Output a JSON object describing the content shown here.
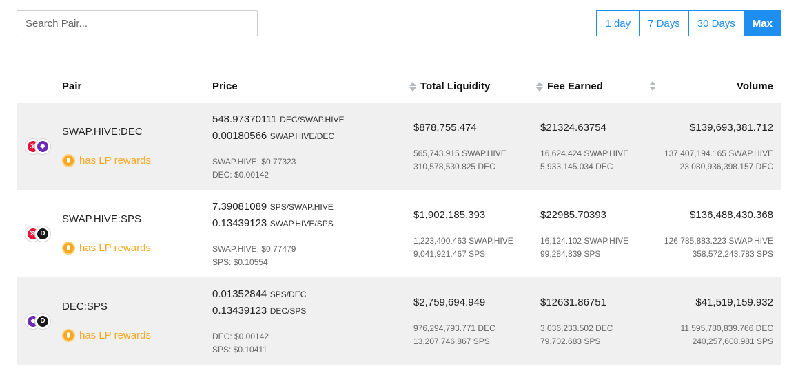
{
  "search": {
    "placeholder": "Search Pair..."
  },
  "periods": [
    {
      "label": "1 day",
      "active": false
    },
    {
      "label": "7 Days",
      "active": false
    },
    {
      "label": "30 Days",
      "active": false
    },
    {
      "label": "Max",
      "active": true
    }
  ],
  "colors": {
    "accent": "#1f8ef1",
    "lp": "#f6a823",
    "row_shade": "#f0f0f0",
    "hive": "#e31337",
    "dec": "#6b2bb5",
    "sps": "#1a1a1a"
  },
  "header": {
    "pair": "Pair",
    "price": "Price",
    "liquidity": "Total Liquidity",
    "fee": "Fee Earned",
    "volume": "Volume"
  },
  "lp_label": "has LP rewards",
  "rows": [
    {
      "pair": "SWAP.HIVE:DEC",
      "icons": [
        "hive-icon",
        "dec-icon"
      ],
      "price1": "548.97370111",
      "unit1": "DEC/SWAP.HIVE",
      "price2": "0.00180566",
      "unit2": "SWAP.HIVE/DEC",
      "usd1": "SWAP.HIVE: $0.77323",
      "usd2": "DEC: $0.00142",
      "liquidity": "$878,755.474",
      "liq1": "565,743.915 SWAP.HIVE",
      "liq2": "310,578,530.825 DEC",
      "fee": "$21324.63754",
      "fee1": "16,624.424 SWAP.HIVE",
      "fee2": "5,933,145.034 DEC",
      "volume": "$139,693,381.712",
      "vol1": "137,407,194.165 SWAP.HIVE",
      "vol2": "23,080,936,398.157 DEC"
    },
    {
      "pair": "SWAP.HIVE:SPS",
      "icons": [
        "hive-icon",
        "sps-icon"
      ],
      "price1": "7.39081089",
      "unit1": "SPS/SWAP.HIVE",
      "price2": "0.13439123",
      "unit2": "SWAP.HIVE/SPS",
      "usd1": "SWAP.HIVE: $0.77479",
      "usd2": "SPS: $0.10554",
      "liquidity": "$1,902,185.393",
      "liq1": "1,223,400.463 SWAP.HIVE",
      "liq2": "9,041,921.467 SPS",
      "fee": "$22985.70393",
      "fee1": "16,124.102 SWAP.HIVE",
      "fee2": "99,284.839 SPS",
      "volume": "$136,488,430.368",
      "vol1": "126,785,883.223 SWAP.HIVE",
      "vol2": "358,572,243.783 SPS"
    },
    {
      "pair": "DEC:SPS",
      "icons": [
        "dec-icon",
        "sps-icon"
      ],
      "price1": "0.01352844",
      "unit1": "SPS/DEC",
      "price2": "0.13439123",
      "unit2": "DEC/SPS",
      "usd1": "DEC: $0.00142",
      "usd2": "SPS: $0.10411",
      "liquidity": "$2,759,694.949",
      "liq1": "976,294,793.771 DEC",
      "liq2": "13,207,746.867 SPS",
      "fee": "$12631.86751",
      "fee1": "3,036,233.502 DEC",
      "fee2": "79,702.683 SPS",
      "volume": "$41,519,159.932",
      "vol1": "11,595,780,839.766 DEC",
      "vol2": "240,257,608.981 SPS"
    }
  ]
}
